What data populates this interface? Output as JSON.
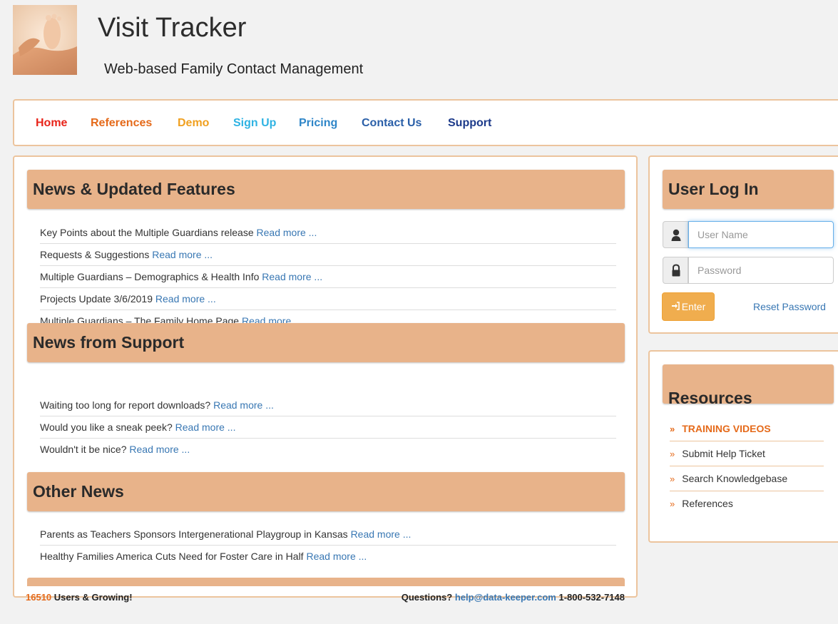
{
  "header": {
    "title": "Visit Tracker",
    "subtitle": "Web-based Family Contact Management"
  },
  "nav": {
    "items": [
      {
        "label": "Home",
        "color": "#e8241a"
      },
      {
        "label": "References",
        "color": "#e56a1a"
      },
      {
        "label": "Demo",
        "color": "#f0a020"
      },
      {
        "label": "Sign Up",
        "color": "#2fb3e3"
      },
      {
        "label": "Pricing",
        "color": "#2f86c8"
      },
      {
        "label": "Contact Us",
        "color": "#2a5fa8"
      },
      {
        "label": "Support",
        "color": "#1c3a8a"
      }
    ]
  },
  "sections": [
    {
      "title": "News & Updated Features",
      "items": [
        {
          "text": "Key Points about the Multiple Guardians release ",
          "link": "Read more ..."
        },
        {
          "text": "Requests & Suggestions ",
          "link": "Read more ..."
        },
        {
          "text": "Multiple Guardians – Demographics & Health Info ",
          "link": "Read more ..."
        },
        {
          "text": "Projects Update 3/6/2019 ",
          "link": "Read more ..."
        },
        {
          "text": "Multiple Guardians – The Family Home Page ",
          "link": "Read more ..."
        }
      ]
    },
    {
      "title": "News from Support",
      "items": [
        {
          "text": "Waiting too long for report downloads? ",
          "link": "Read more ..."
        },
        {
          "text": "Would you like a sneak peek? ",
          "link": "Read more ..."
        },
        {
          "text": "Wouldn't it be nice? ",
          "link": "Read more ..."
        }
      ]
    },
    {
      "title": "Other News",
      "items": [
        {
          "text": "Parents as Teachers Sponsors Intergenerational Playgroup in Kansas ",
          "link": "Read more ..."
        },
        {
          "text": "Healthy Families America Cuts Need for Foster Care in Half ",
          "link": "Read more ..."
        }
      ]
    }
  ],
  "footer": {
    "user_count": "16510",
    "users_text": " Users & Growing!",
    "questions_label": "Questions? ",
    "email": "help@data-keeper.com",
    "phone": " 1-800-532-7148"
  },
  "login": {
    "title": "User Log In",
    "username_placeholder": "User Name",
    "password_placeholder": "Password",
    "enter_label": "Enter",
    "reset_label": "Reset Password",
    "icons": {
      "user": "user-icon",
      "password": "lock-icon",
      "enter": "sign-in-icon"
    }
  },
  "resources": {
    "title": "Resources",
    "items": [
      {
        "label": "TRAINING VIDEOS",
        "highlight": true
      },
      {
        "label": "Submit Help Ticket",
        "highlight": false
      },
      {
        "label": "Search Knowledgebase",
        "highlight": false
      },
      {
        "label": "References",
        "highlight": false
      }
    ]
  },
  "colors": {
    "accent": "#e8b38a",
    "border": "#ecc49d",
    "link": "#3877b3",
    "orange": "#e56a1a",
    "button": "#f0ad4e"
  }
}
